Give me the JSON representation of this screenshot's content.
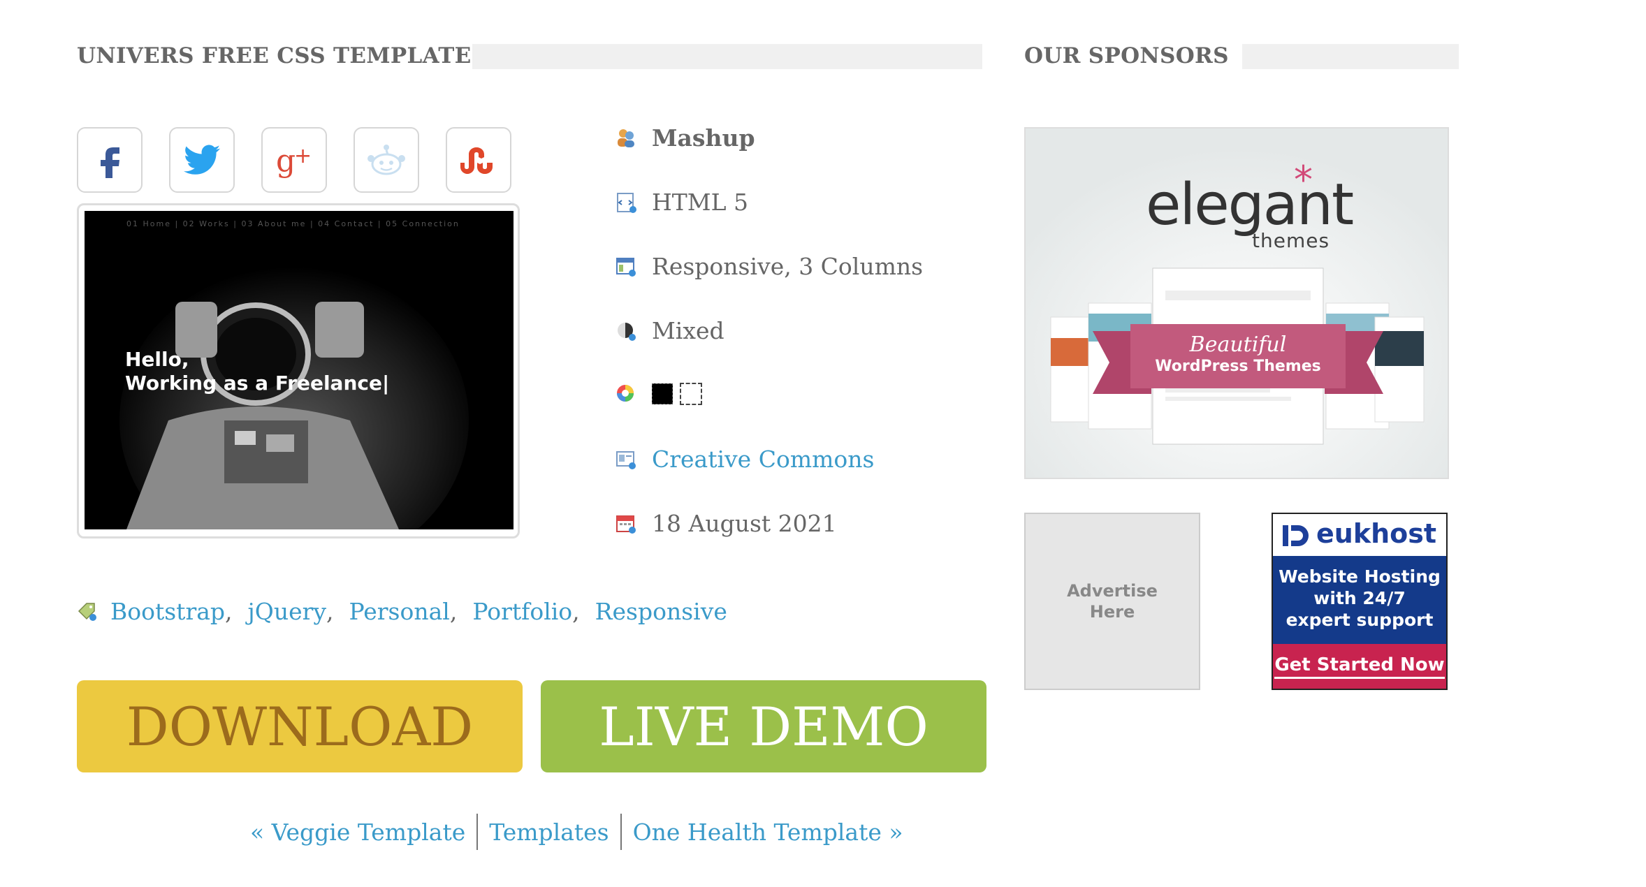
{
  "main": {
    "title": "UNIVERS FREE CSS TEMPLATE",
    "social": [
      {
        "name": "facebook"
      },
      {
        "name": "twitter"
      },
      {
        "name": "google-plus"
      },
      {
        "name": "reddit"
      },
      {
        "name": "stumbleupon"
      }
    ],
    "preview": {
      "nav_text": "01   Home   | 02   Works   | 03   About me   | 04   Contact   | 05   Connection",
      "hello_text": "Hello,\nWorking as a Freelance|"
    },
    "meta": {
      "category": "Mashup",
      "html_version": "HTML 5",
      "layout": "Responsive, 3 Columns",
      "style": "Mixed",
      "license": "Creative Commons",
      "date": "18 August 2021"
    },
    "tags": [
      "Bootstrap",
      "jQuery",
      "Personal",
      "Portfolio",
      "Responsive"
    ],
    "download_label": "DOWNLOAD",
    "live_demo_label": "LIVE DEMO",
    "pager": {
      "prev": "« Veggie Template",
      "index": "Templates",
      "next": "One Health Template »"
    }
  },
  "sponsors": {
    "title": "OUR SPONSORS",
    "elegant": {
      "brand": "elegant",
      "sub": "themes",
      "ribbon_line1": "Beautiful",
      "ribbon_line2": "WordPress Themes"
    },
    "advertise": "Advertise\nHere",
    "eukhost": {
      "brand": "eukhost",
      "text": "Website Hosting with 24/7 expert support",
      "cta": "Get Started Now"
    }
  },
  "colors": {
    "link": "#3a9ac9",
    "download_bg": "#ecc940",
    "download_text": "#9c6b1c",
    "live_bg": "#9bc04a",
    "eukhost_bg": "#143a8a",
    "eukhost_cta": "#c8234f"
  }
}
